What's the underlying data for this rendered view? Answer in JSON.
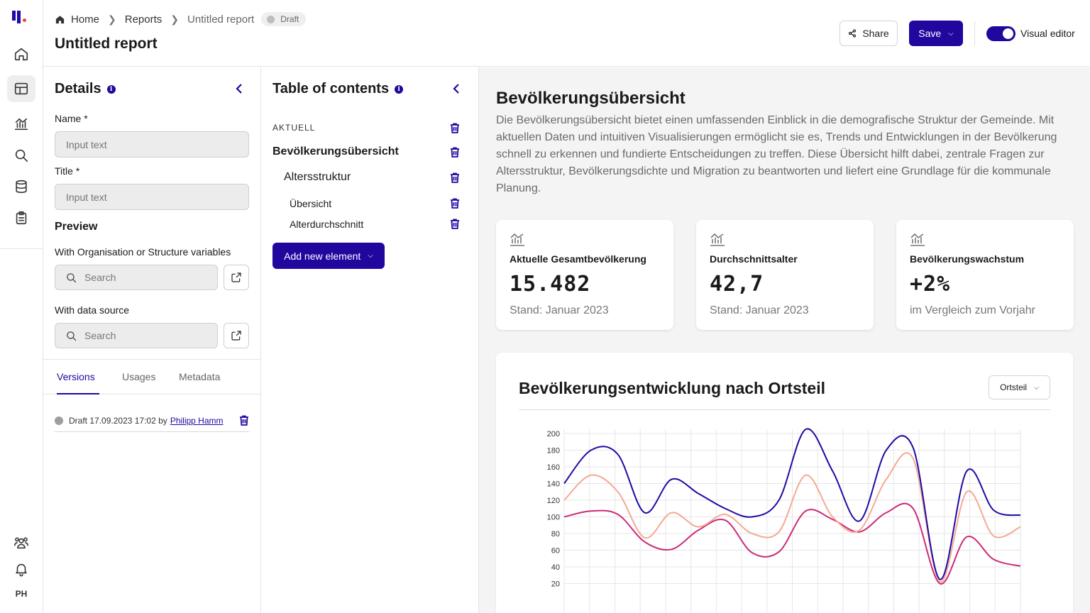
{
  "app": {
    "logo": "logo-mark",
    "avatar_initials": "PH"
  },
  "rail": {
    "items": [
      {
        "name": "home",
        "icon": "home-icon"
      },
      {
        "name": "reports",
        "icon": "layout-icon",
        "active": true
      },
      {
        "name": "analytics",
        "icon": "chart-icon"
      },
      {
        "name": "search",
        "icon": "search-icon"
      },
      {
        "name": "database",
        "icon": "database-icon"
      },
      {
        "name": "tasks",
        "icon": "clipboard-icon"
      }
    ],
    "bottom": [
      {
        "name": "team",
        "icon": "users-icon"
      },
      {
        "name": "notifications",
        "icon": "bell-icon"
      }
    ]
  },
  "header": {
    "breadcrumb": {
      "home": "Home",
      "reports": "Reports",
      "current": "Untitled report"
    },
    "badge": "Draft",
    "title": "Untitled report",
    "share_label": "Share",
    "save_label": "Save",
    "toggle_label": "Visual editor",
    "toggle_on": true
  },
  "details": {
    "title": "Details",
    "name_label": "Name *",
    "name_placeholder": "Input text",
    "title_label": "Title *",
    "title_placeholder": "Input text",
    "preview_heading": "Preview",
    "org_label": "With Organisation or Structure variables",
    "org_search_placeholder": "Search",
    "source_label": "With data source",
    "source_search_placeholder": "Search",
    "tabs": [
      "Versions",
      "Usages",
      "Metadata"
    ],
    "version": {
      "status": "Draft",
      "date": "17.09.2023 17:02",
      "by": "by",
      "author": "Philipp Hamm"
    }
  },
  "toc": {
    "title": "Table of contents",
    "section_label": "AKTUELL",
    "items": [
      {
        "label": "Bevölkerungsübersicht",
        "level": 1
      },
      {
        "label": "Altersstruktur",
        "level": 2
      },
      {
        "label": "Übersicht",
        "level": 3
      },
      {
        "label": "Alterdurchschnitt",
        "level": 3
      }
    ],
    "add_label": "Add new element"
  },
  "main": {
    "title": "Bevölkerungsübersicht",
    "description": "Die Bevölkerungsübersicht bietet einen umfassenden Einblick in die demografische Struktur der Gemeinde. Mit aktuellen Daten und intuitiven Visualisierungen ermöglicht sie es, Trends und Entwicklungen in der Bevölkerung schnell zu erkennen und fundierte Entscheidungen zu treffen. Diese Übersicht hilft dabei, zentrale Fragen zur Altersstruktur, Bevölkerungsdichte und Migration zu beantworten und liefert eine Grundlage für die kommunale Planung.",
    "kpis": [
      {
        "label": "Aktuelle Gesamtbevölkerung",
        "value": "15.482",
        "sub": "Stand: Januar 2023"
      },
      {
        "label": "Durchschnittsalter",
        "value": "42,7",
        "sub": "Stand: Januar 2023"
      },
      {
        "label": "Bevölkerungswachstum",
        "value": "+2%",
        "sub": "im Vergleich zum Vorjahr"
      }
    ],
    "chart_title": "Bevölkerungsentwicklung nach Ortsteil",
    "chart_select": "Ortsteil"
  },
  "chart_data": {
    "type": "line",
    "title": "Bevölkerungsentwicklung nach Ortsteil",
    "xlabel": "",
    "ylabel": "",
    "y_ticks": [
      20,
      40,
      60,
      80,
      100,
      120,
      140,
      160,
      180,
      200
    ],
    "ylim": [
      20,
      200
    ],
    "grid": true,
    "x": [
      0,
      1,
      2,
      3,
      4,
      5,
      6,
      7,
      8,
      9,
      10,
      11,
      12,
      13,
      14,
      15,
      16,
      17
    ],
    "series": [
      {
        "color": "#1f0aa3",
        "values": [
          140,
          180,
          175,
          105,
          145,
          128,
          110,
          100,
          120,
          205,
          155,
          95,
          180,
          183,
          25,
          155,
          108,
          102
        ]
      },
      {
        "color": "#f5a993",
        "values": [
          120,
          150,
          130,
          75,
          105,
          88,
          103,
          80,
          82,
          150,
          100,
          84,
          145,
          170,
          22,
          130,
          77,
          88
        ]
      },
      {
        "color": "#cc2a78",
        "values": [
          100,
          107,
          103,
          70,
          61,
          84,
          96,
          57,
          58,
          107,
          97,
          82,
          105,
          110,
          20,
          76,
          49,
          41
        ]
      }
    ]
  }
}
